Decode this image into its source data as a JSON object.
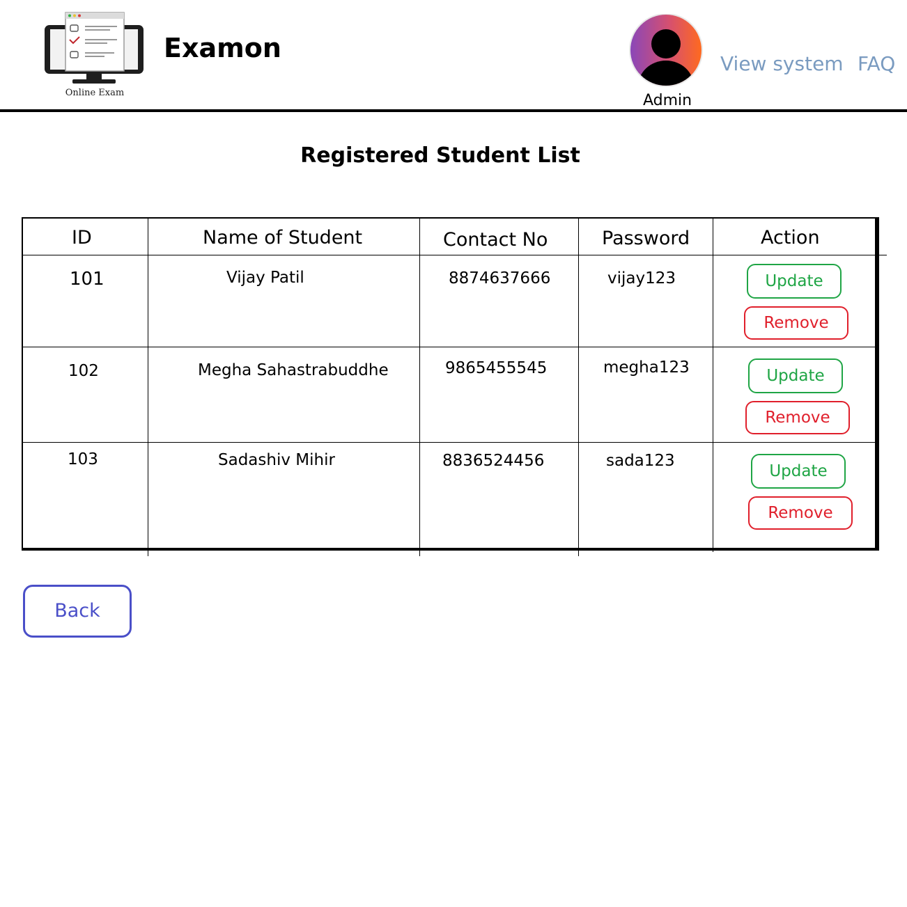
{
  "header": {
    "logo_caption": "Online Exam",
    "app_title": "Examon",
    "admin_label": "Admin",
    "nav": {
      "view_system": "View system",
      "faq": "FAQ"
    }
  },
  "page": {
    "title": "Registered Student List"
  },
  "table": {
    "columns": [
      "ID",
      "Name of Student",
      "Contact No",
      "Password",
      "Action"
    ],
    "rows": [
      {
        "id": "101",
        "name": "Vijay Patil",
        "contact": "8874637666",
        "password": "vijay123",
        "update_label": "Update",
        "remove_label": "Remove"
      },
      {
        "id": "102",
        "name": "Megha Sahastrabuddhe",
        "contact": "9865455545",
        "password": "megha123",
        "update_label": "Update",
        "remove_label": "Remove"
      },
      {
        "id": "103",
        "name": "Sadashiv Mihir",
        "contact": "8836524456",
        "password": "sada123",
        "update_label": "Update",
        "remove_label": "Remove"
      }
    ]
  },
  "footer": {
    "back_label": "Back"
  },
  "colors": {
    "update": "#1fa545",
    "remove": "#e01f2b",
    "back": "#4a4fc8",
    "nav_link": "#7a9bc0"
  },
  "icons": {
    "logo": "computer-checklist-icon",
    "avatar": "user-avatar-icon"
  }
}
